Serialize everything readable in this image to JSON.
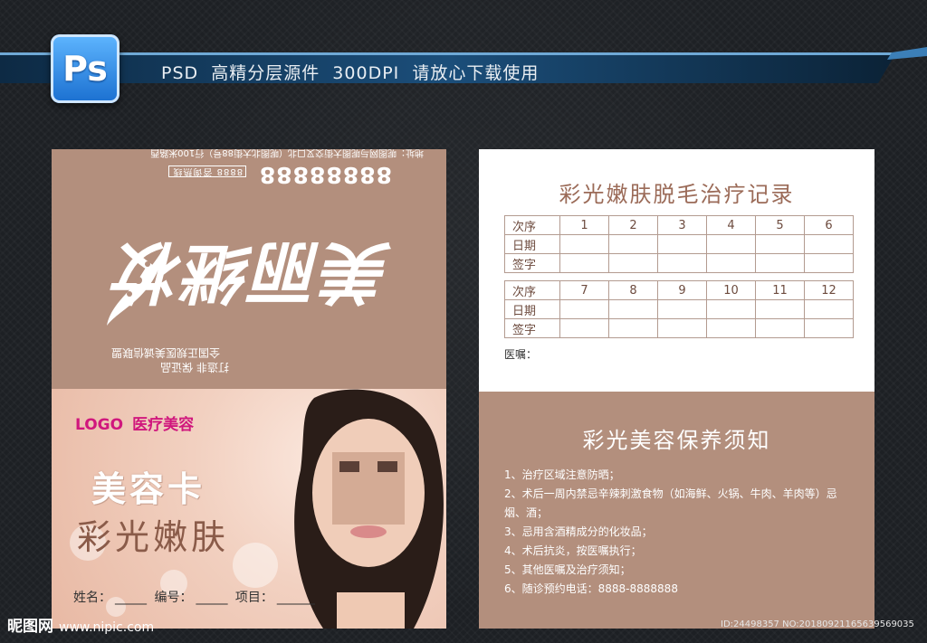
{
  "banner": {
    "icon": "photoshop-logo-icon",
    "logo_text": "Ps",
    "text": "PSD  高精分层源件  300DPI  请放心下载使用"
  },
  "front": {
    "flipped": {
      "slogan1": "打造非  保证品",
      "slogan2": "全国正规医美诚信联盟",
      "phone_tag": "8888",
      "phone_small": "咨询热线",
      "phone": "88888888",
      "address": "地址：呢图网与呢图大街交叉口北（呢图北大街88号）行100米路西",
      "brand": "美丽继妆"
    },
    "logo": "LOGO",
    "logo_sub": "医疗美容",
    "title1": "美容卡",
    "title2": "彩光嫩肤",
    "fields": {
      "name_label": "姓名：",
      "name_value": "_____",
      "no_label": "编号：",
      "no_value": "_____",
      "item_label": "项目：",
      "item_value": "______"
    }
  },
  "back": {
    "record_title": "彩光嫩肤脱毛治疗记录",
    "row_labels": [
      "次序",
      "日期",
      "签字"
    ],
    "table1": [
      "1",
      "2",
      "3",
      "4",
      "5",
      "6"
    ],
    "table2": [
      "7",
      "8",
      "9",
      "10",
      "11",
      "12"
    ],
    "advice_label": "医嘱：",
    "notice_title": "彩光美容保养须知",
    "notice_items": [
      "1、治疗区域注意防晒；",
      "2、术后一周内禁忌辛辣刺激食物（如海鲜、火锅、牛肉、羊肉等）忌烟、酒；",
      "3、忌用含酒精成分的化妆品；",
      "4、术后抗炎，按医嘱执行；",
      "5、其他医嘱及治疗须知；",
      "6、随诊预约电话：8888-8888888"
    ]
  },
  "watermark": {
    "site_name": "昵图网",
    "url": "www.nipic.com",
    "id_text": "ID:24498357 NO:20180921165639569035"
  }
}
